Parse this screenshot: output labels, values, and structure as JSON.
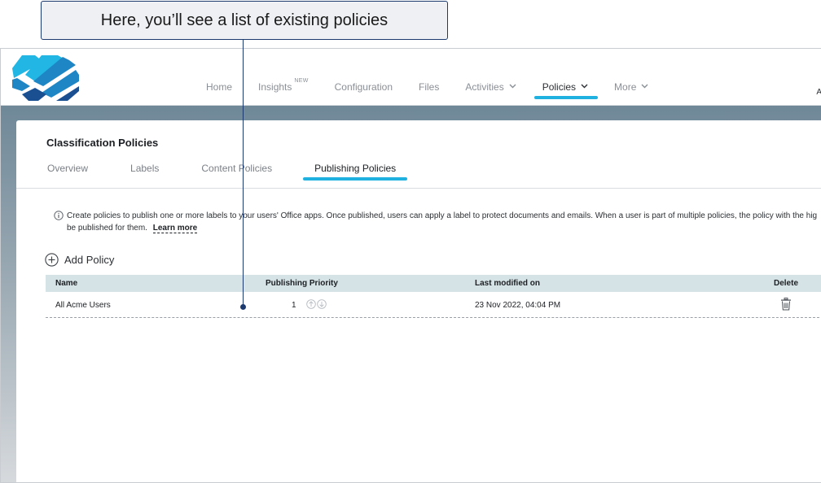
{
  "callout": {
    "text": "Here, you’ll see a list of existing policies"
  },
  "nav": {
    "items": [
      {
        "label": "Home",
        "badge": "",
        "dropdown": false,
        "active": false
      },
      {
        "label": "Insights",
        "badge": "NEW",
        "dropdown": false,
        "active": false
      },
      {
        "label": "Configuration",
        "badge": "",
        "dropdown": false,
        "active": false
      },
      {
        "label": "Files",
        "badge": "",
        "dropdown": false,
        "active": false
      },
      {
        "label": "Activities",
        "badge": "",
        "dropdown": true,
        "active": false
      },
      {
        "label": "Policies",
        "badge": "",
        "dropdown": true,
        "active": true
      },
      {
        "label": "More",
        "badge": "",
        "dropdown": true,
        "active": false
      }
    ],
    "cutoff_text": "A"
  },
  "page": {
    "title": "Classification Policies",
    "tabs": [
      {
        "label": "Overview",
        "active": false
      },
      {
        "label": "Labels",
        "active": false
      },
      {
        "label": "Content Policies",
        "active": false
      },
      {
        "label": "Publishing Policies",
        "active": true
      }
    ],
    "info": {
      "line1": "Create policies to publish one or more labels to your users' Office apps. Once published, users can apply a label to protect documents and emails. When a user is part of multiple policies, the policy with the hig",
      "line2": "be published for them.",
      "learn_more": "Learn more"
    },
    "add_policy_label": "Add Policy",
    "table": {
      "columns": [
        "Name",
        "Publishing Priority",
        "Last modified on",
        "Delete"
      ],
      "rows": [
        {
          "name": "All Acme Users",
          "priority": "1",
          "last_modified": "23 Nov 2022, 04:04 PM"
        }
      ]
    }
  },
  "colors": {
    "accent": "#1fb2e0",
    "callout_border": "#1d3a6e",
    "table_header": "#d5e3e6",
    "logo_light": "#21b6e3",
    "logo_mid": "#1f86c5",
    "logo_dark": "#1a4f92"
  }
}
